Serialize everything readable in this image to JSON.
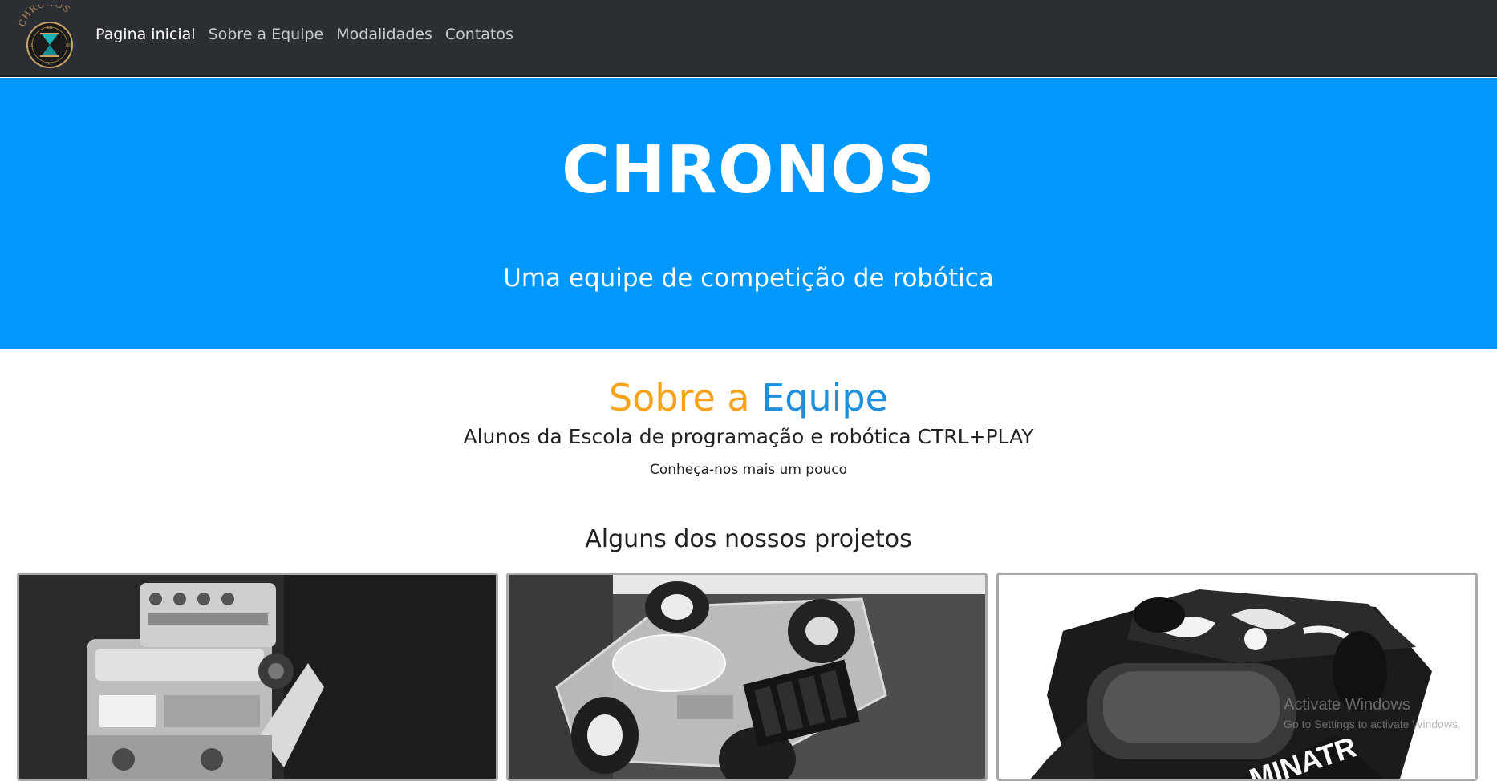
{
  "navbar": {
    "logo_text": "CHRONOS",
    "links": [
      "Pagina inicial",
      "Sobre a Equipe",
      "Modalidades",
      "Contatos"
    ]
  },
  "hero": {
    "title": "CHRONOS",
    "subtitle": "Uma equipe de competição de robótica"
  },
  "about": {
    "title_word1": "Sobre a",
    "title_word2": "Equipe",
    "subtitle": "Alunos da Escola de programação e robótica CTRL+PLAY",
    "tagline": "Conheça-nos mais um pouco"
  },
  "projects": {
    "title": "Alguns dos nossos projetos"
  },
  "watermark": {
    "line1": "Activate Windows",
    "line2": "Go to Settings to activate Windows."
  },
  "colors": {
    "navbar": "#2b2f33",
    "hero": "#0198fe",
    "accent_orange": "#f5a31a",
    "accent_blue": "#1e8fdb"
  }
}
